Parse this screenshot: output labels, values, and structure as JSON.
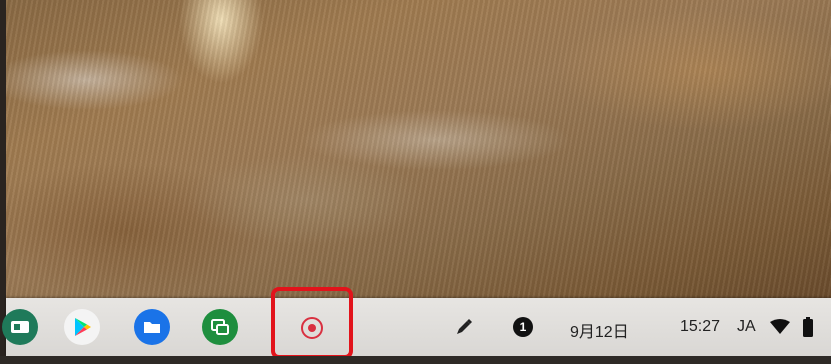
{
  "shelf": {
    "apps": [
      {
        "name": "partial-app",
        "icon": "app-icon-partial"
      },
      {
        "name": "play-store",
        "icon": "play-store-icon"
      },
      {
        "name": "files",
        "icon": "folder-icon"
      },
      {
        "name": "remote-desktop",
        "icon": "remote-desktop-icon"
      }
    ],
    "screen_record": {
      "icon": "stop-record-icon",
      "highlight_color": "#e2131b",
      "accent": "#d93040"
    },
    "tray": {
      "stylus_icon": "stylus-icon",
      "notification_count": "1",
      "date": "9月12日",
      "time": "15:27",
      "ime": "JA",
      "wifi_icon": "wifi-icon",
      "battery_icon": "battery-icon"
    }
  }
}
